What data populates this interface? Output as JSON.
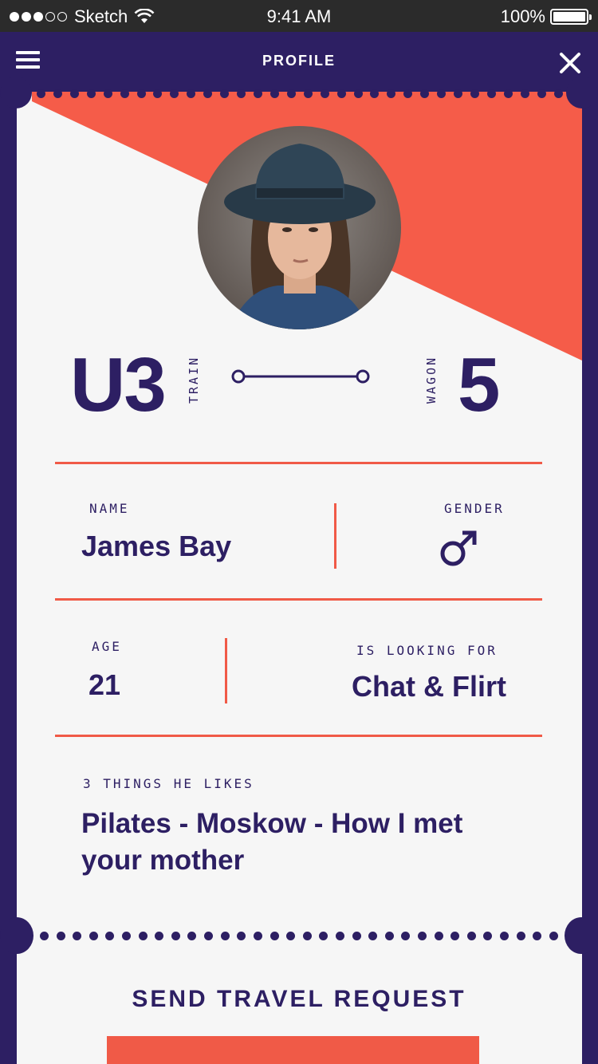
{
  "status_bar": {
    "carrier": "Sketch",
    "time": "9:41 AM",
    "battery": "100%"
  },
  "nav": {
    "title": "PROFILE",
    "menu_icon": "menu-icon",
    "close_icon": "close-icon"
  },
  "ticket": {
    "train_code": "U3",
    "train_label": "TRAIN",
    "wagon_label": "WAGON",
    "wagon_number": "5",
    "name_label": "NAME",
    "name_value": "James Bay",
    "gender_label": "GENDER",
    "gender_icon": "male-icon",
    "age_label": "AGE",
    "age_value": "21",
    "looking_label": "IS LOOKING FOR",
    "looking_value": "Chat & Flirt",
    "likes_label": "3 THINGS HE LIKES",
    "likes_value": "Pilates - Moskow - How I met your mother"
  },
  "cta": {
    "label": "SEND TRAVEL REQUEST"
  },
  "colors": {
    "primary": "#2d1f63",
    "accent": "#f05a47",
    "card": "#f6f6f6"
  }
}
